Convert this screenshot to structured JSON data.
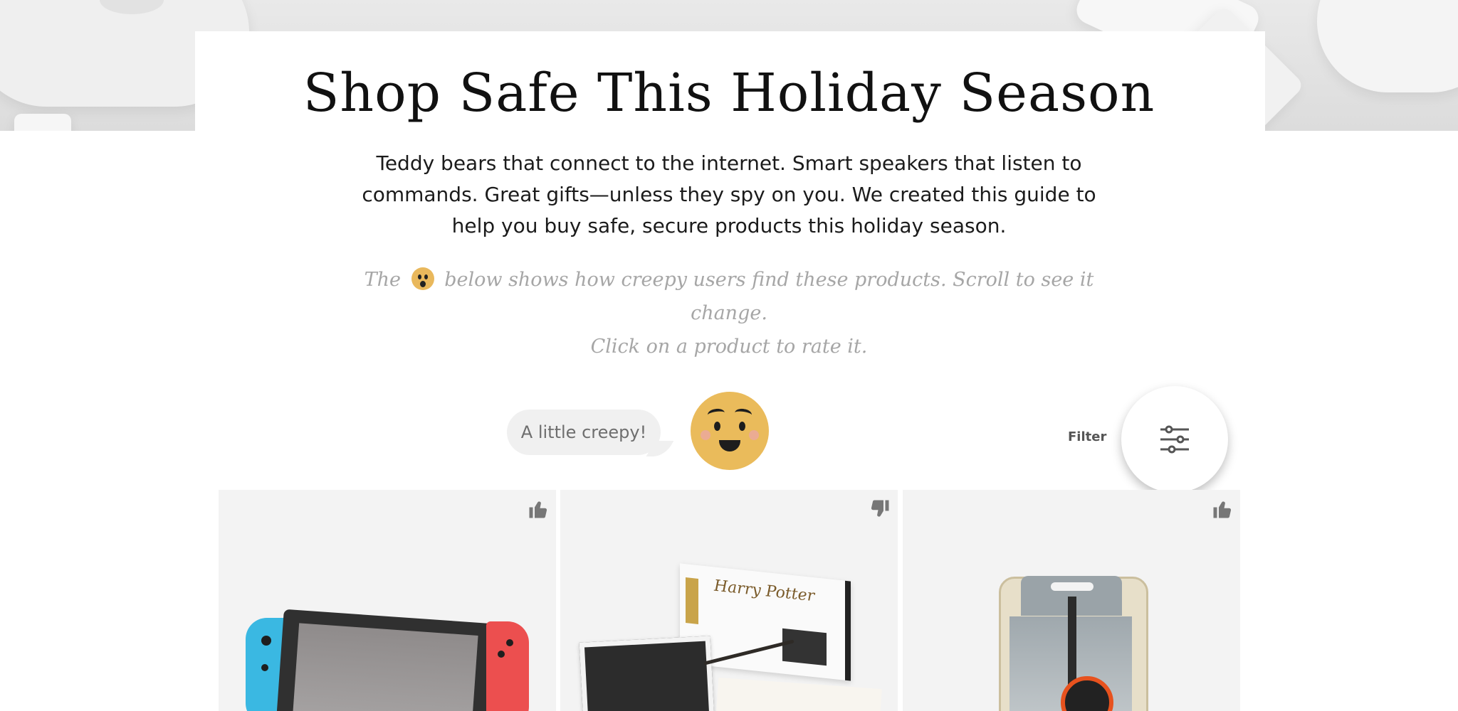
{
  "header": {
    "title": "Shop Safe This Holiday Season",
    "intro": "Teddy bears that connect to the internet. Smart speakers that listen to commands. Great gifts—unless they spy on you. We created this guide to help you buy safe, secure products this holiday season.",
    "note_before": "The",
    "note_after": "below shows how creepy users find these products. Scroll to see it change.",
    "note_line2": "Click on a product to rate it."
  },
  "creep_meter": {
    "label": "A little creepy!",
    "face_icon": "slightly-creepy-face-icon"
  },
  "filter": {
    "label": "Filter",
    "icon": "sliders-icon"
  },
  "products": [
    {
      "vote_icon": "thumbs-up-icon",
      "image": "nintendo-switch"
    },
    {
      "vote_icon": "thumbs-down-icon",
      "image": "harry-potter-coding-kit"
    },
    {
      "vote_icon": "thumbs-up-icon",
      "image": "bluetooth-tracker"
    }
  ],
  "colors": {
    "face": "#eabb5b",
    "bubble": "#f0f0f0",
    "tile": "#f3f3f3"
  }
}
